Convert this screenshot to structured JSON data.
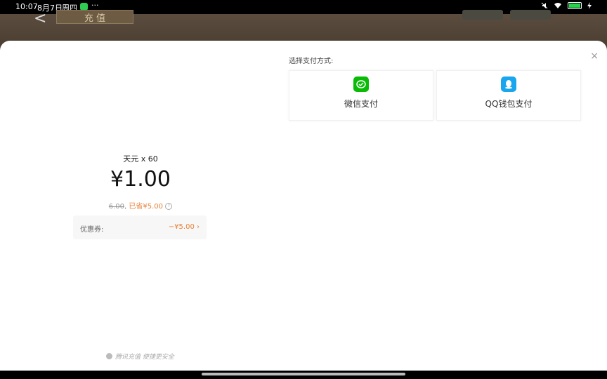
{
  "status_bar": {
    "time": "10:07",
    "date": "8月7日",
    "weekday": "周四",
    "more": "···",
    "battery_percent": 100
  },
  "game_background": {
    "back_glyph": "<",
    "title_plate": "充 值"
  },
  "payment": {
    "title": "选择支付方式:",
    "close": "×",
    "options": [
      {
        "label": "微信支付",
        "icon": "wechat-pay-icon",
        "color": "#09bb07"
      },
      {
        "label": "QQ钱包支付",
        "icon": "qq-wallet-icon",
        "color": "#1aa6ee"
      }
    ]
  },
  "order": {
    "product": "天元 x 60",
    "price": "¥1.00",
    "original_price": "6.00",
    "separator": ",",
    "saved": "已省¥5.00"
  },
  "coupon": {
    "label": "优惠券:",
    "value": "−¥5.00 ›"
  },
  "footer": {
    "text": "腾讯充值 便捷更安全"
  },
  "colors": {
    "accent_orange": "#e8823a",
    "wechat_green": "#09bb07",
    "qq_blue": "#1aa6ee"
  }
}
